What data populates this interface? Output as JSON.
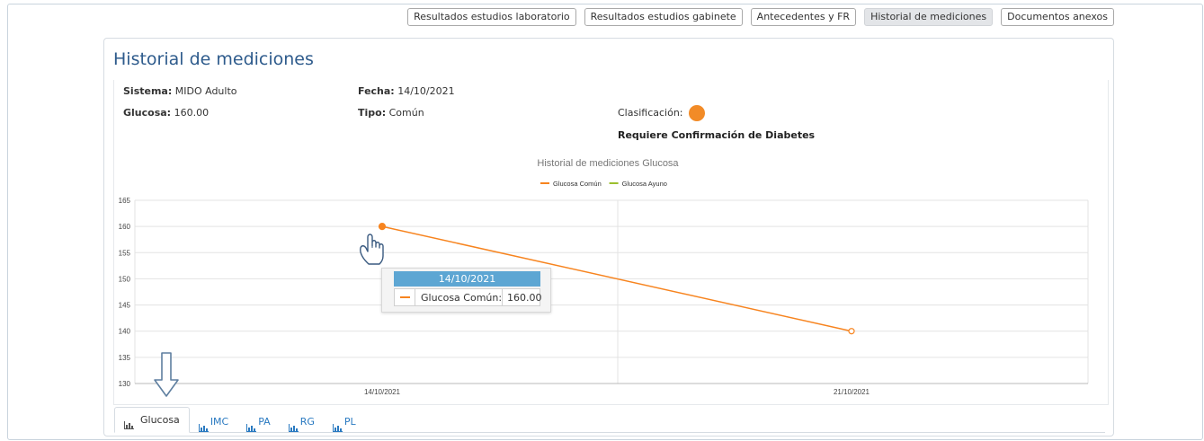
{
  "top_tabs": [
    {
      "label": "Resultados estudios laboratorio",
      "active": false
    },
    {
      "label": "Resultados estudios gabinete",
      "active": false
    },
    {
      "label": "Antecedentes y FR",
      "active": false
    },
    {
      "label": "Historial de mediciones",
      "active": true
    },
    {
      "label": "Documentos anexos",
      "active": false
    }
  ],
  "panel": {
    "title": "Historial de mediciones",
    "sistema_label": "Sistema:",
    "sistema_value": "MIDO Adulto",
    "fecha_label": "Fecha:",
    "fecha_value": "14/10/2021",
    "glucosa_label": "Glucosa:",
    "glucosa_value": "160.00",
    "tipo_label": "Tipo:",
    "tipo_value": "Común",
    "clasificacion_label": "Clasificación:",
    "clasificacion_color": "#f28b27",
    "clasificacion_text": "Requiere Confirmación de Diabetes"
  },
  "chart_data": {
    "type": "line",
    "title": "Historial de mediciones Glucosa",
    "categories": [
      "14/10/2021",
      "21/10/2021"
    ],
    "series": [
      {
        "name": "Glucosa Común",
        "color": "#f7841f",
        "values": [
          160,
          140
        ]
      },
      {
        "name": "Glucosa Ayuno",
        "color": "#9cbf2d",
        "values": []
      }
    ],
    "ylim": [
      130,
      165
    ],
    "yticks": [
      130,
      135,
      140,
      145,
      150,
      155,
      160,
      165
    ],
    "legend": "top-center",
    "grid": true
  },
  "tooltip": {
    "date": "14/10/2021",
    "series_label": "Glucosa Común:",
    "value": "160.00"
  },
  "bottom_tabs": [
    {
      "label": "Glucosa",
      "active": true
    },
    {
      "label": "IMC",
      "active": false
    },
    {
      "label": "PA",
      "active": false
    },
    {
      "label": "RG",
      "active": false
    },
    {
      "label": "PL",
      "active": false
    }
  ]
}
